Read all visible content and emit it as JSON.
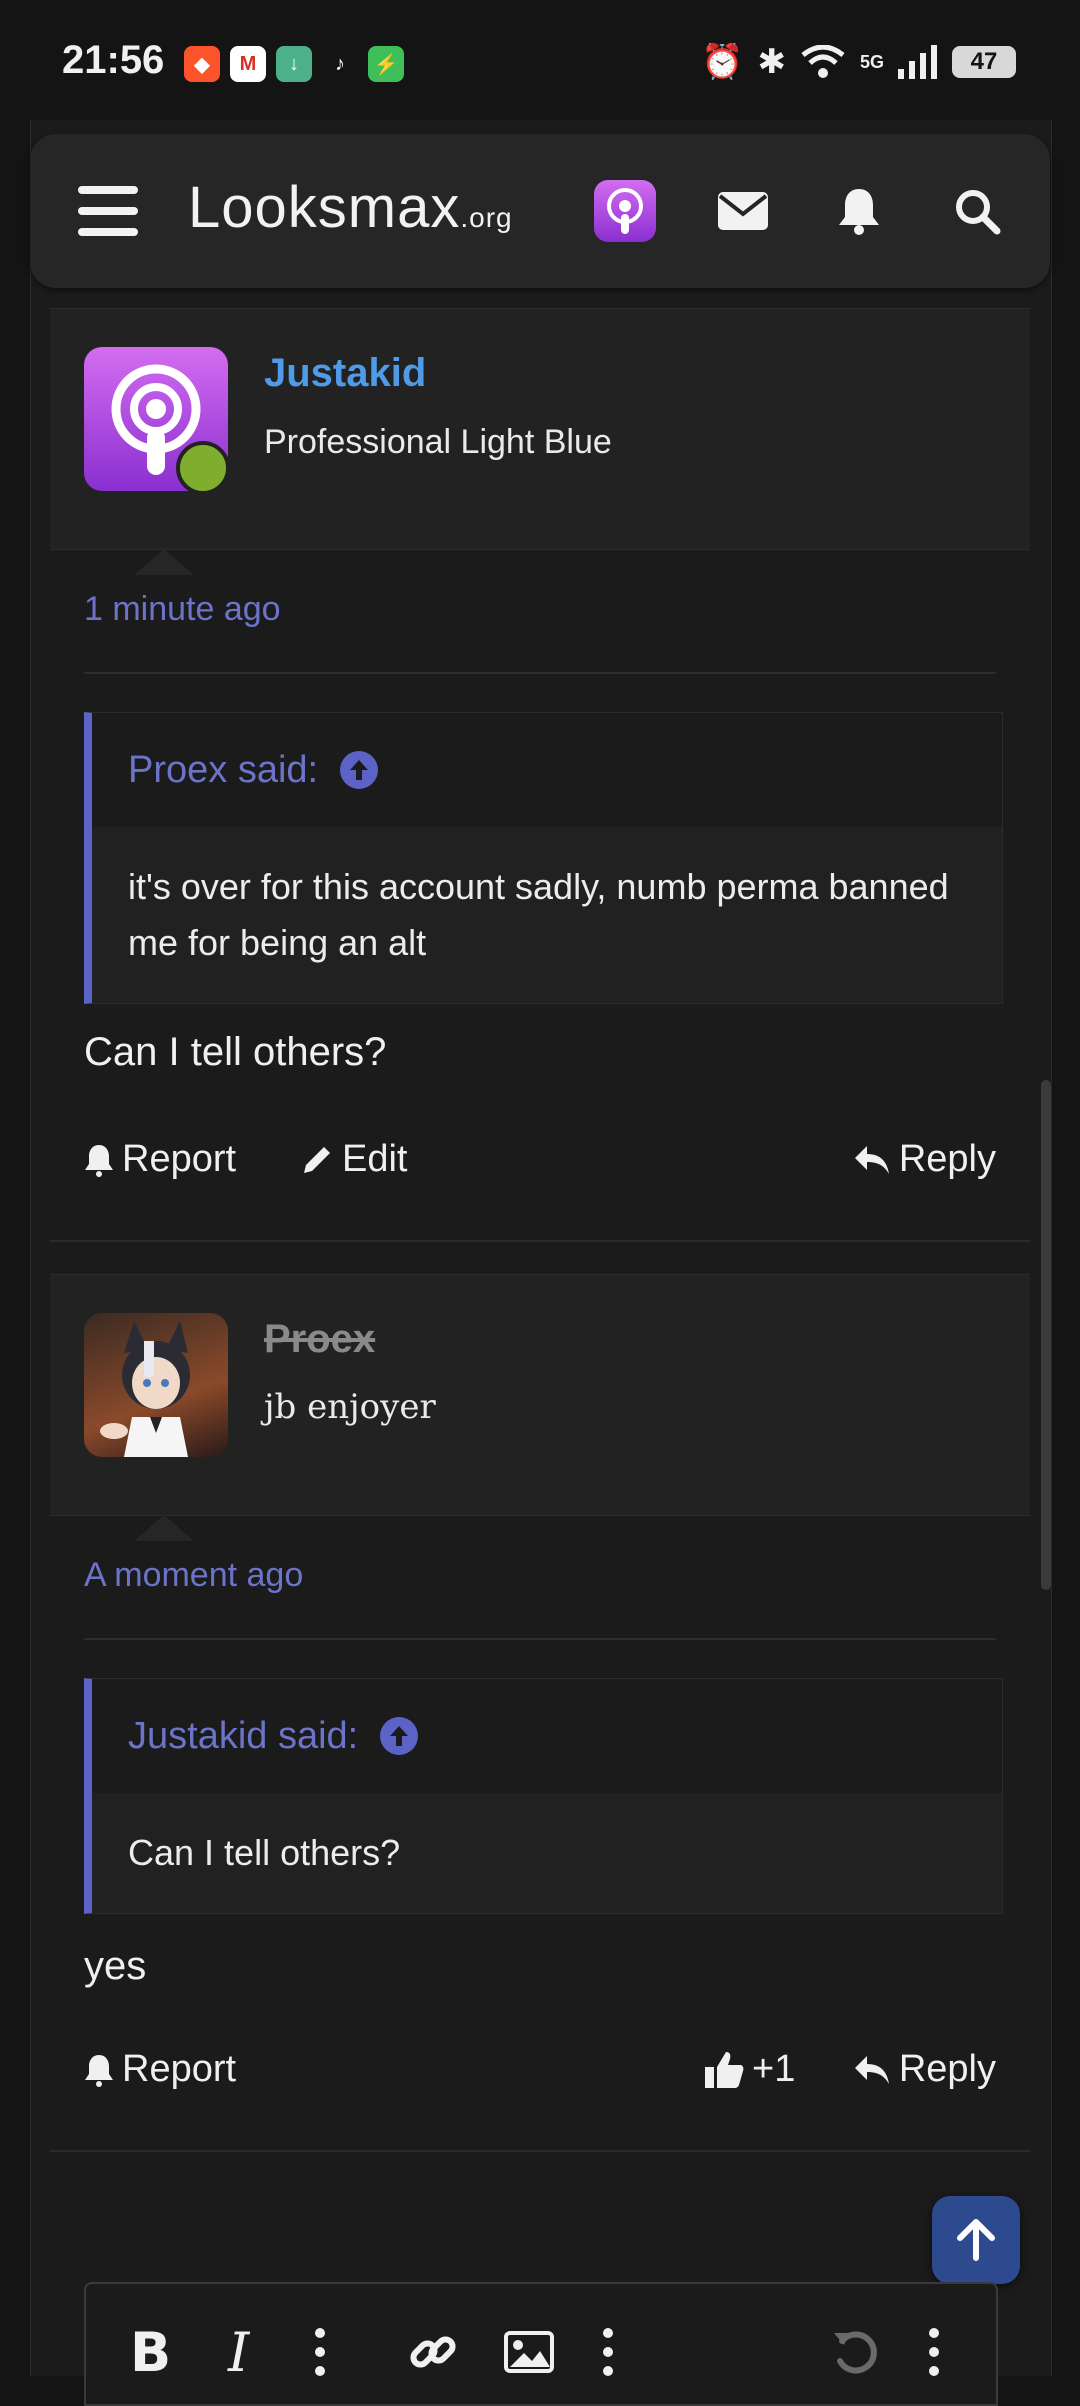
{
  "status_bar": {
    "time": "21:56",
    "battery": "47",
    "network": "5G"
  },
  "header": {
    "logo_main": "Looksmax",
    "logo_suffix": ".org"
  },
  "posts": [
    {
      "username": "Justakid",
      "user_title": "Professional Light Blue",
      "time": "1 minute ago",
      "quote_author": "Proex said:",
      "quote_text": "it's over for this account sadly, numb perma banned me for being an alt",
      "message": "Can I tell others?",
      "actions": {
        "report": "Report",
        "edit": "Edit",
        "reply": "Reply"
      }
    },
    {
      "username": "Proex",
      "user_title": "jb enjoyer",
      "time": "A moment ago",
      "quote_author": "Justakid said:",
      "quote_text": "Can I tell others?",
      "message": "yes",
      "actions": {
        "report": "Report",
        "like_count": "+1",
        "reply": "Reply"
      }
    }
  ],
  "colors": {
    "accent": "#5b63c6",
    "username": "#4f9be8",
    "online": "#7fae2f",
    "background": "#1b1b1b"
  }
}
